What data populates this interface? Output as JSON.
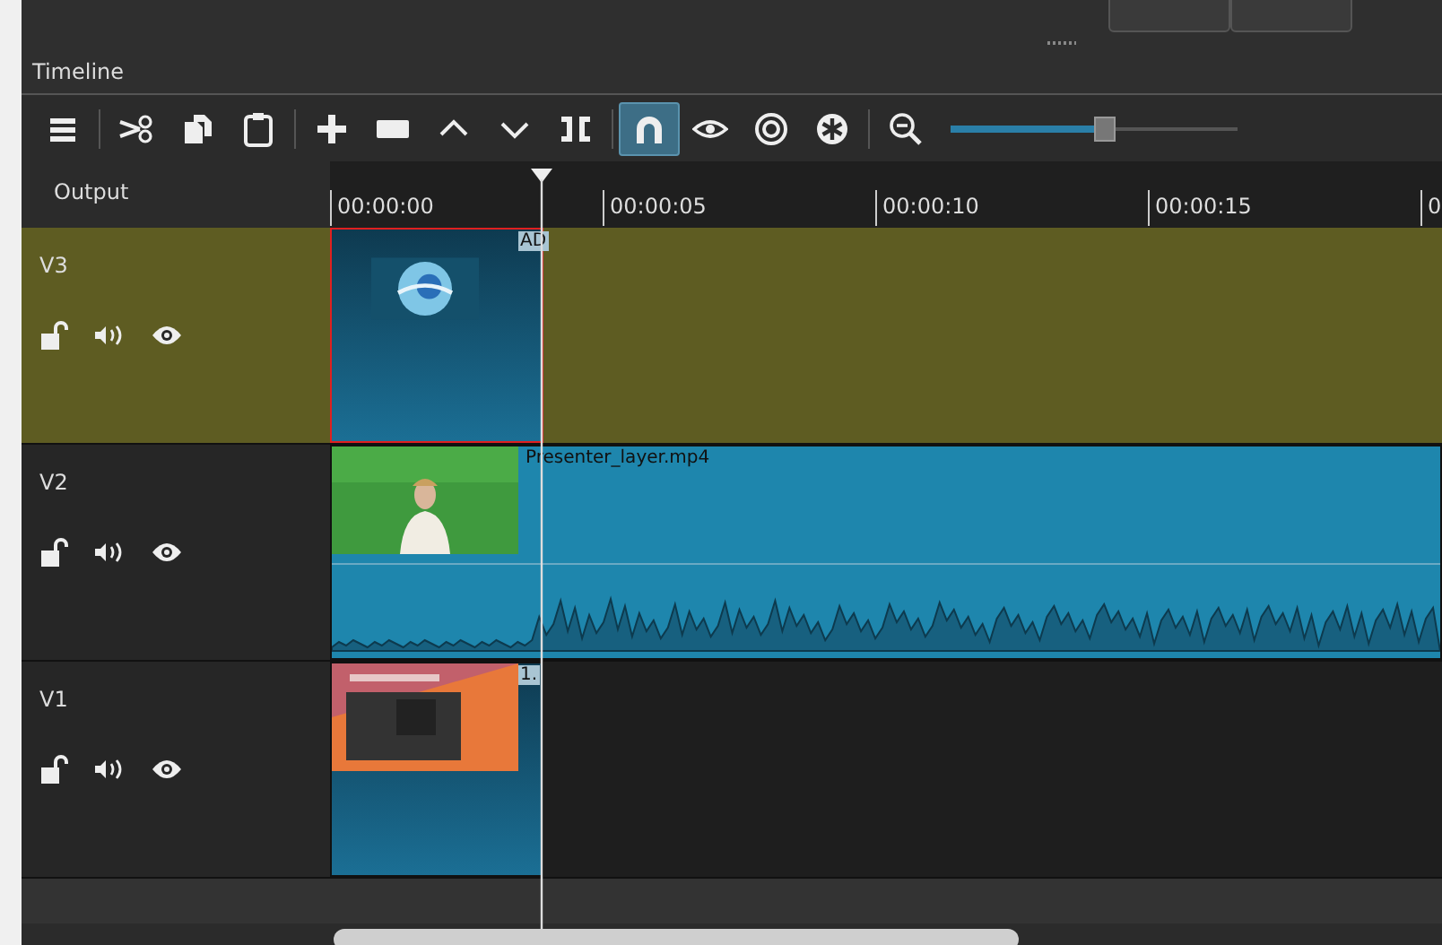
{
  "panel": {
    "title": "Timeline"
  },
  "toolbar": {
    "buttons": [
      {
        "selected": false
      },
      {
        "selected": false
      },
      {
        "selected": false
      },
      {
        "selected": false
      },
      {
        "selected": false
      },
      {
        "selected": false
      },
      {
        "selected": false
      },
      {
        "selected": false
      },
      {
        "selected": false
      },
      {
        "selected": true
      },
      {
        "selected": false
      },
      {
        "selected": false
      },
      {
        "selected": false
      },
      {
        "selected": false
      }
    ],
    "zoom": {
      "level": 0.53
    }
  },
  "ruler": {
    "output_label": "Output",
    "ticks": [
      "00:00:00",
      "00:00:05",
      "00:00:10",
      "00:00:15",
      "0"
    ]
  },
  "tracks": [
    {
      "name": "V3",
      "selected": true,
      "clip": {
        "label": "AD",
        "selected": true
      }
    },
    {
      "name": "V2",
      "selected": false,
      "clip": {
        "label": "Presenter_layer.mp4",
        "selected": false,
        "kind": "video"
      }
    },
    {
      "name": "V1",
      "selected": false,
      "clip": {
        "label": "1.",
        "selected": false
      }
    }
  ]
}
